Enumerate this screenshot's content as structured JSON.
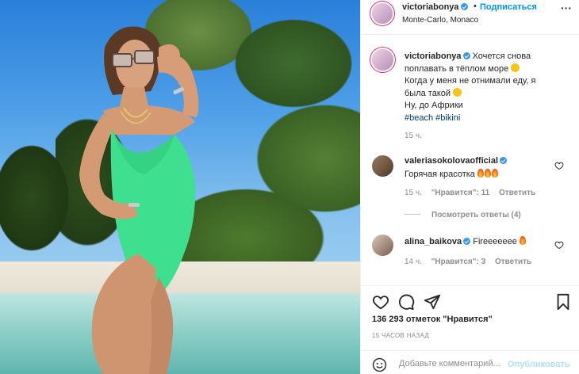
{
  "post": {
    "author": "victoriabonya",
    "follow_label": "Подписаться",
    "location": "Monte-Carlo, Monaco",
    "caption": {
      "line1": "Хочется снова",
      "line2": "поплавать в тёплом море",
      "line3": "Когда у меня не отнимали еду, я",
      "line4": "была такой",
      "line5": "Ну, до Африки",
      "tags": "#beach #bikini",
      "time": "15 ч."
    },
    "comments": [
      {
        "user": "valeriasokolovaofficial",
        "text": "Горячая красотка",
        "time": "15 ч.",
        "likes": "\"Нравится\": 11",
        "reply": "Ответить",
        "view_replies": "Посмотреть ответы (4)"
      },
      {
        "user": "alina_baikova",
        "text": "Fireeeeeee",
        "time": "14 ч.",
        "likes": "\"Нравится\": 3",
        "reply": "Ответить"
      }
    ],
    "likes_count": "136 293 отметок \"Нравится\"",
    "posted_ago": "15 ЧАСОВ НАЗАД",
    "add_comment_placeholder": "Добавьте комментарий...",
    "publish_label": "Опубликовать"
  },
  "icons": {
    "like": "heart-icon",
    "comment": "comment-icon",
    "share": "share-icon",
    "save": "bookmark-icon",
    "more": "more-icon",
    "emoji": "emoji-icon"
  },
  "colors": {
    "link_blue": "#0095f6",
    "hashtag": "#00376b",
    "muted": "#8e8e8e",
    "swimsuit": "#3ee08f"
  }
}
